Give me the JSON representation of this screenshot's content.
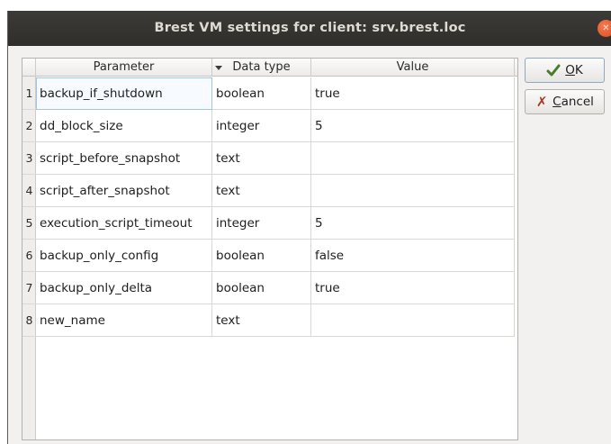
{
  "window": {
    "title": "Brest VM settings for client: srv.brest.loc"
  },
  "table": {
    "columns": [
      "Parameter",
      "Data type",
      "Value"
    ],
    "rows": [
      {
        "num": "1",
        "parameter": "backup_if_shutdown",
        "data_type": "boolean",
        "value": "true"
      },
      {
        "num": "2",
        "parameter": "dd_block_size",
        "data_type": "integer",
        "value": "5"
      },
      {
        "num": "3",
        "parameter": "script_before_snapshot",
        "data_type": "text",
        "value": ""
      },
      {
        "num": "4",
        "parameter": "script_after_snapshot",
        "data_type": "text",
        "value": ""
      },
      {
        "num": "5",
        "parameter": "execution_script_timeout",
        "data_type": "integer",
        "value": "5"
      },
      {
        "num": "6",
        "parameter": "backup_only_config",
        "data_type": "boolean",
        "value": "false"
      },
      {
        "num": "7",
        "parameter": "backup_only_delta",
        "data_type": "boolean",
        "value": "true"
      },
      {
        "num": "8",
        "parameter": "new_name",
        "data_type": "text",
        "value": ""
      }
    ]
  },
  "buttons": {
    "ok": {
      "mnemonic": "O",
      "rest": "K",
      "icon": "checkmark-icon"
    },
    "cancel": {
      "mnemonic": "C",
      "rest": "ancel",
      "icon": "cross-icon"
    }
  },
  "colors": {
    "titlebar": "#3c3b37",
    "close": "#e4572e",
    "selection": "#9dc6e8"
  }
}
